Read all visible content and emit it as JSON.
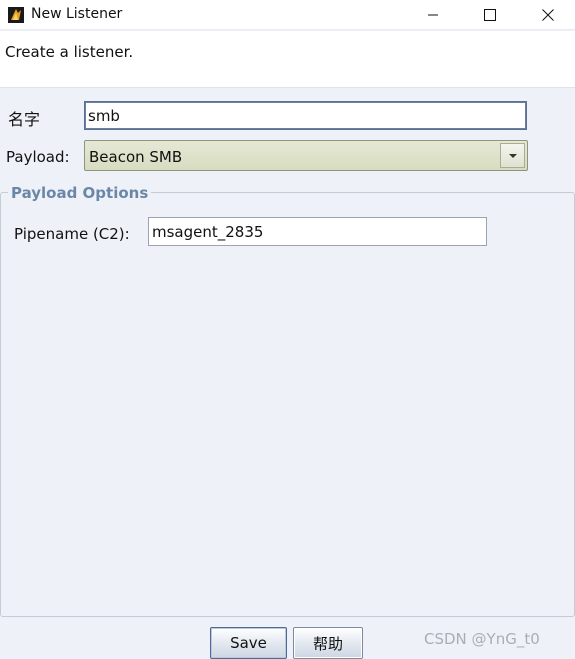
{
  "window": {
    "title": "New Listener",
    "icon": "cobalt-strike-app-icon",
    "controls": [
      "minimize-icon",
      "maximize-icon",
      "close-icon"
    ]
  },
  "header": {
    "description": "Create a listener."
  },
  "form": {
    "name_label": "名字",
    "name_value": "smb",
    "payload_label": "Payload:",
    "payload_value": "Beacon SMB"
  },
  "payload_options": {
    "legend": "Payload Options",
    "pipename_label": "Pipename (C2):",
    "pipename_value": "msagent_2835"
  },
  "buttons": {
    "save_label": "Save",
    "help_label": "帮助"
  },
  "watermark": "CSDN @YnG_t0",
  "colors": {
    "background": "#eef2f8",
    "combo_fill": "#dcdfc7",
    "legend_text": "#6b87a8"
  }
}
